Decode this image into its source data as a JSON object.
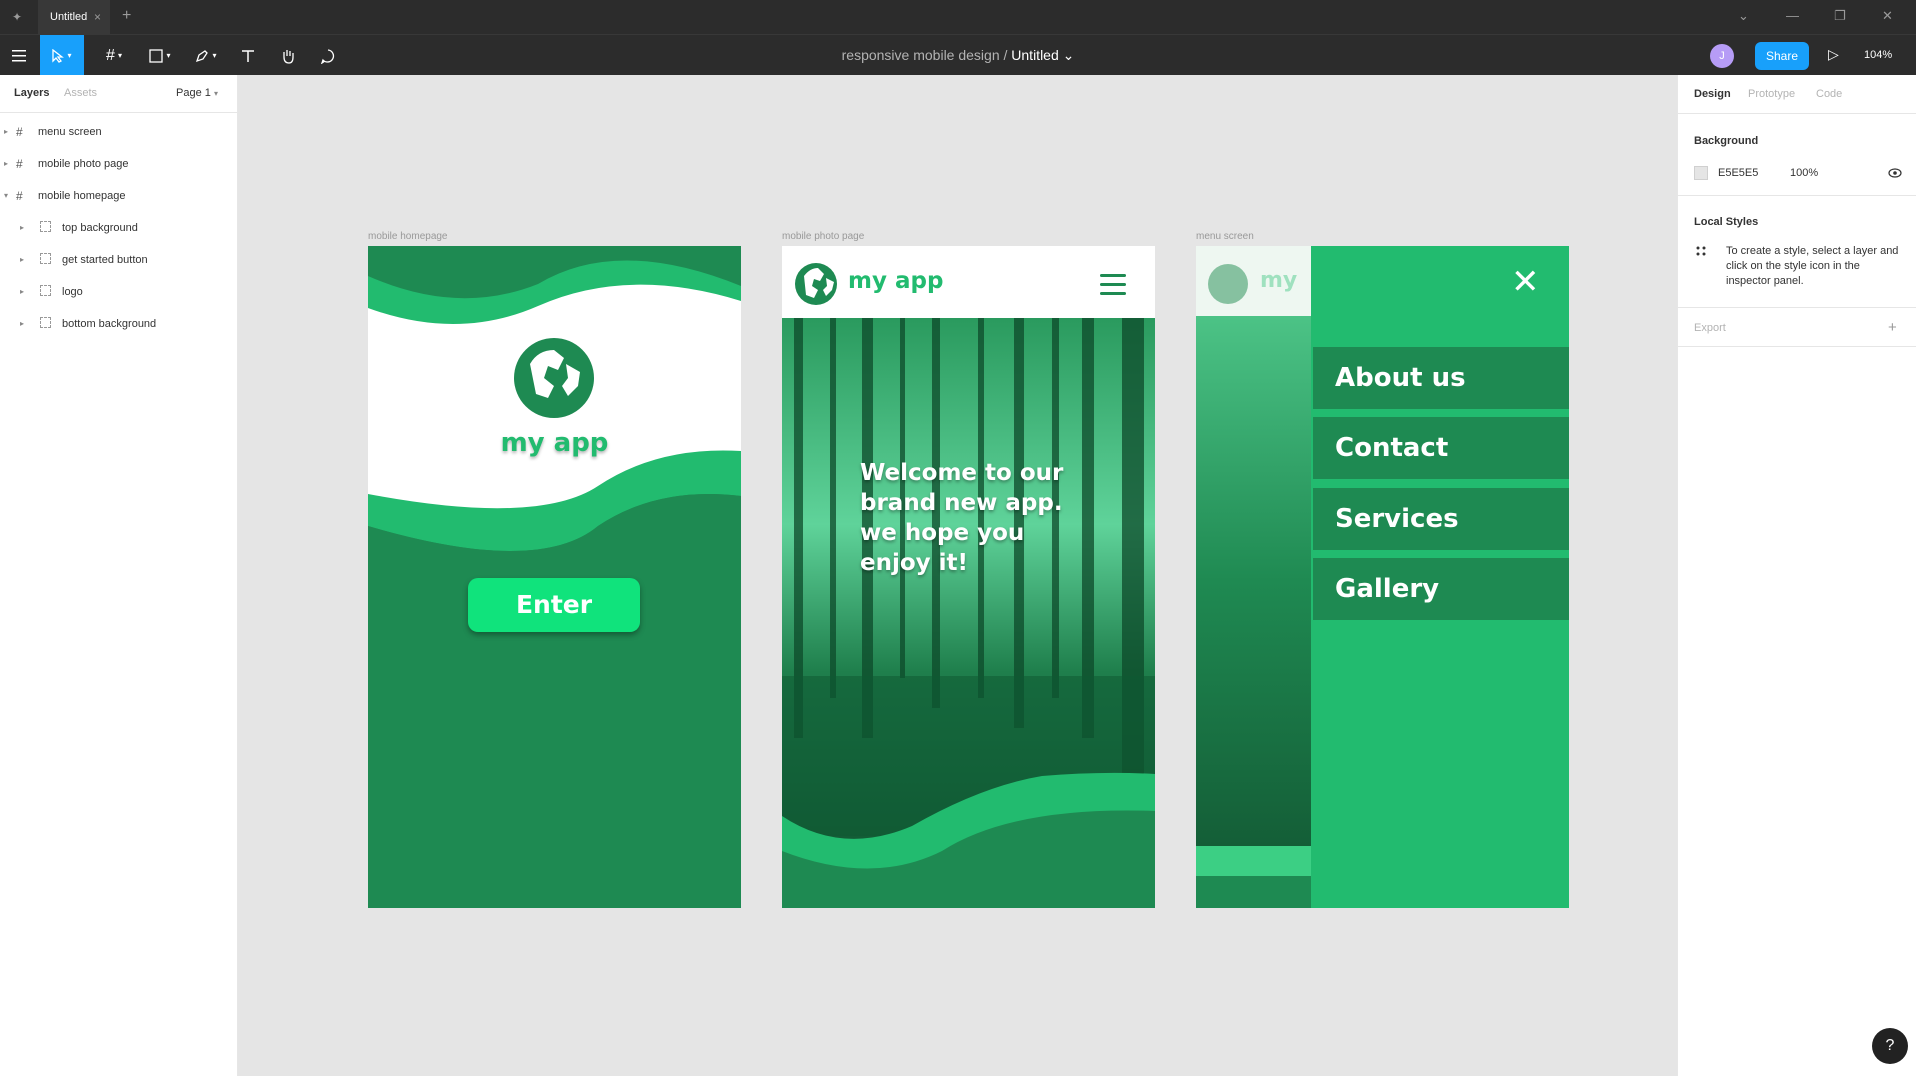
{
  "titlebar": {
    "tab_title": "Untitled",
    "close_glyph": "×",
    "add_glyph": "+",
    "chevron_glyph": "⌄",
    "minimize_glyph": "—",
    "restore_glyph": "❐",
    "closewin_glyph": "✕"
  },
  "toolbar": {
    "project": "responsive mobile design",
    "separator": "/",
    "file": "Untitled",
    "file_caret": "⌄",
    "avatar_initial": "J",
    "share_label": "Share",
    "play_glyph": "▷",
    "zoom": "104%"
  },
  "left_panel": {
    "tabs": [
      "Layers",
      "Assets"
    ],
    "page": "Page 1",
    "layers": [
      {
        "label": "menu screen",
        "type": "frame"
      },
      {
        "label": "mobile photo page",
        "type": "frame"
      },
      {
        "label": "mobile homepage",
        "type": "frame",
        "expanded": true
      },
      {
        "label": "top background",
        "type": "group"
      },
      {
        "label": "get started button",
        "type": "group"
      },
      {
        "label": "logo",
        "type": "group"
      },
      {
        "label": "bottom background",
        "type": "group"
      }
    ]
  },
  "right_panel": {
    "tabs": [
      "Design",
      "Prototype",
      "Code"
    ],
    "background_heading": "Background",
    "background_hex": "E5E5E5",
    "background_opacity": "100%",
    "local_styles_heading": "Local Styles",
    "local_styles_hint": "To create a style, select a layer and click on the style icon in the inspector panel.",
    "export_heading": "Export",
    "add_glyph": "+",
    "help_glyph": "?"
  },
  "canvas": {
    "frames": [
      {
        "label": "mobile homepage",
        "app_name": "my app",
        "button_label": "Enter"
      },
      {
        "label": "mobile photo page",
        "app_name": "my app",
        "welcome_lines": [
          "Welcome to our",
          "brand new app.",
          "we hope you",
          "enjoy it!"
        ]
      },
      {
        "label": "menu screen",
        "app_name": "my",
        "close_glyph": "✕",
        "menu_items": [
          "About us",
          "Contact",
          "Services",
          "Gallery"
        ]
      }
    ],
    "colors": {
      "dark_green": "#1e8a52",
      "bright_green": "#22bb6f",
      "button_green": "#10e37c",
      "canvas_bg": "#e5e5e5",
      "selected_tool": "#18a0fb"
    }
  }
}
